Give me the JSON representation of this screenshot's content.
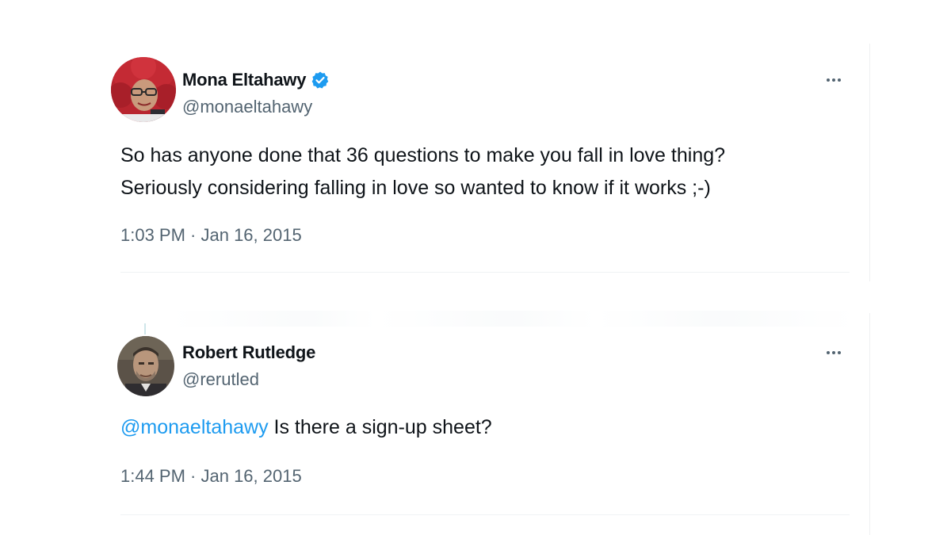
{
  "tweets": [
    {
      "display_name": "Mona Eltahawy",
      "handle": "@monaeltahawy",
      "verified": true,
      "text_lines": [
        "So has anyone done that 36 questions to make you fall in love thing?",
        "Seriously considering falling in love so wanted to know if it works ;-)"
      ],
      "timestamp": "1:03 PM · Jan 16, 2015",
      "avatar_icon": "avatar-red-hair"
    },
    {
      "display_name": "Robert Rutledge",
      "handle": "@rerutled",
      "verified": false,
      "mention": "@monaeltahawy",
      "text": " Is there a sign-up sheet?",
      "timestamp": "1:44 PM · Jan 16, 2015",
      "avatar_icon": "avatar-man"
    }
  ],
  "colors": {
    "text": "#0f1419",
    "secondary": "#536471",
    "accent": "#1d9bf0",
    "divider": "#eff3f4"
  },
  "icons": {
    "verified": "verified-badge-icon",
    "more": "more-options-icon"
  }
}
